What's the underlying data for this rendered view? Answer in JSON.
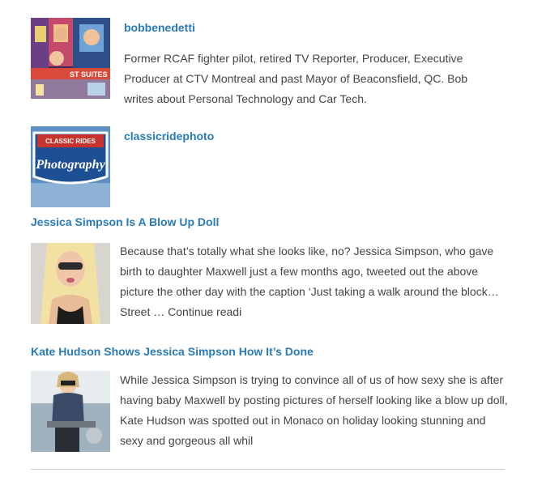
{
  "authors": [
    {
      "name": "bobbenedetti",
      "bio": "Former RCAF fighter pilot, retired TV Reporter, Producer, Executive Producer at CTV Montreal and past Mayor of Beaconsfield, QC. Bob writes about Personal Technology and Car Tech.",
      "photo_text": "ST SUITES"
    },
    {
      "name": "classicridephoto",
      "photo_text_top": "CLASSIC RIDES",
      "photo_text_main": "Photography"
    }
  ],
  "posts": [
    {
      "title": "Jessica Simpson Is A Blow Up Doll",
      "excerpt": "Because that’s totally what she looks like, no?  Jessica Simpson, who gave birth to daughter Maxwell just a few months ago, tweeted out the above picture the other day with the caption ‘Just taking a walk around the block… Street … ",
      "more": "Continue readi"
    },
    {
      "title": "Kate Hudson Shows Jessica Simpson How It’s Done",
      "excerpt": "While Jessica Simpson is trying to convince all of us of how sexy she is after having baby Maxwell by posting pictures of herself looking like a blow up doll, Kate Hudson was spotted out in Monaco on holiday looking stunning and sexy and gorgeous all whil"
    }
  ]
}
